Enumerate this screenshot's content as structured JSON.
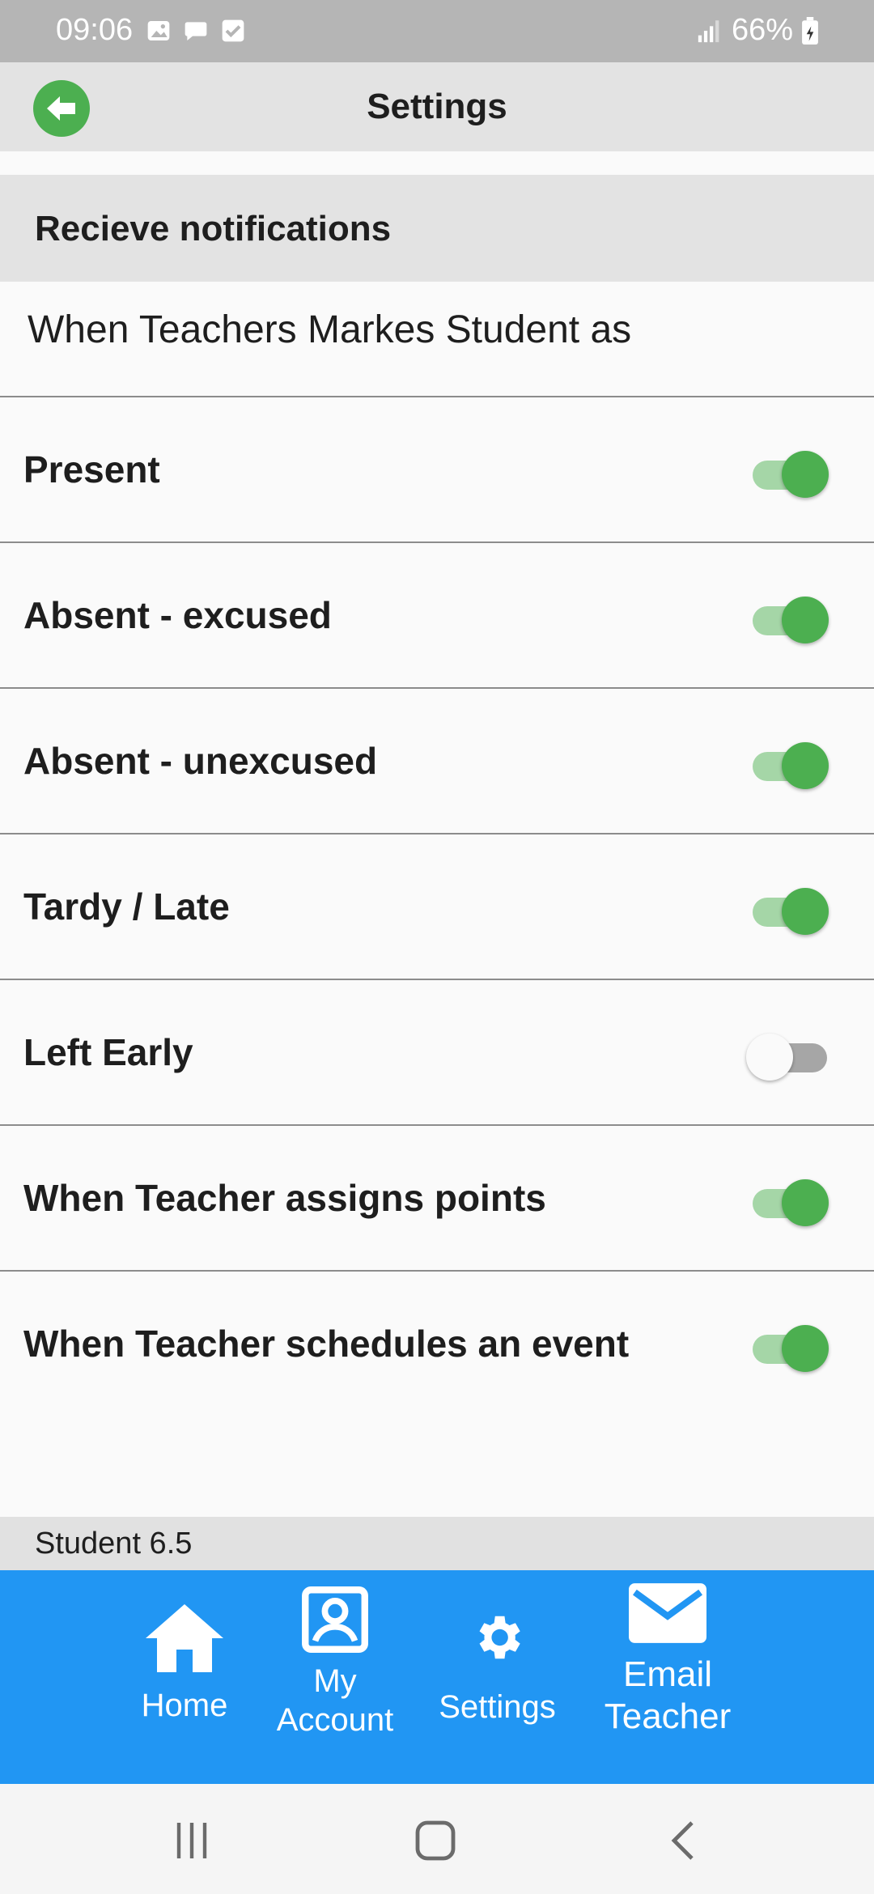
{
  "status_bar": {
    "time": "09:06",
    "battery": "66%",
    "icons": [
      "gallery-icon",
      "message-icon",
      "check-icon",
      "signal-icon",
      "battery-icon"
    ]
  },
  "app_bar": {
    "title": "Settings",
    "back_icon": "back-arrow-icon",
    "accent_color": "#4caf50"
  },
  "section": {
    "title": "Recieve notifications",
    "subtitle": "When Teachers Markes Student as"
  },
  "settings": [
    {
      "label": "Present",
      "enabled": true
    },
    {
      "label": "Absent - excused",
      "enabled": true
    },
    {
      "label": "Absent - unexcused",
      "enabled": true
    },
    {
      "label": "Tardy / Late",
      "enabled": true
    },
    {
      "label": "Left Early",
      "enabled": false
    },
    {
      "label": "When Teacher assigns points",
      "enabled": true
    },
    {
      "label": "When Teacher schedules an event",
      "enabled": true
    }
  ],
  "version": "Student 6.5",
  "bottom_nav": {
    "background_color": "#2196f3",
    "items": [
      {
        "label": "Home",
        "icon": "home-icon"
      },
      {
        "label": "My\nAccount",
        "icon": "account-icon"
      },
      {
        "label": "Settings",
        "icon": "gear-icon"
      },
      {
        "label": "Email\nTeacher",
        "icon": "mail-icon"
      }
    ]
  },
  "system_nav": {
    "icons": [
      "recent-apps-icon",
      "home-circle-icon",
      "back-chevron-icon"
    ]
  }
}
